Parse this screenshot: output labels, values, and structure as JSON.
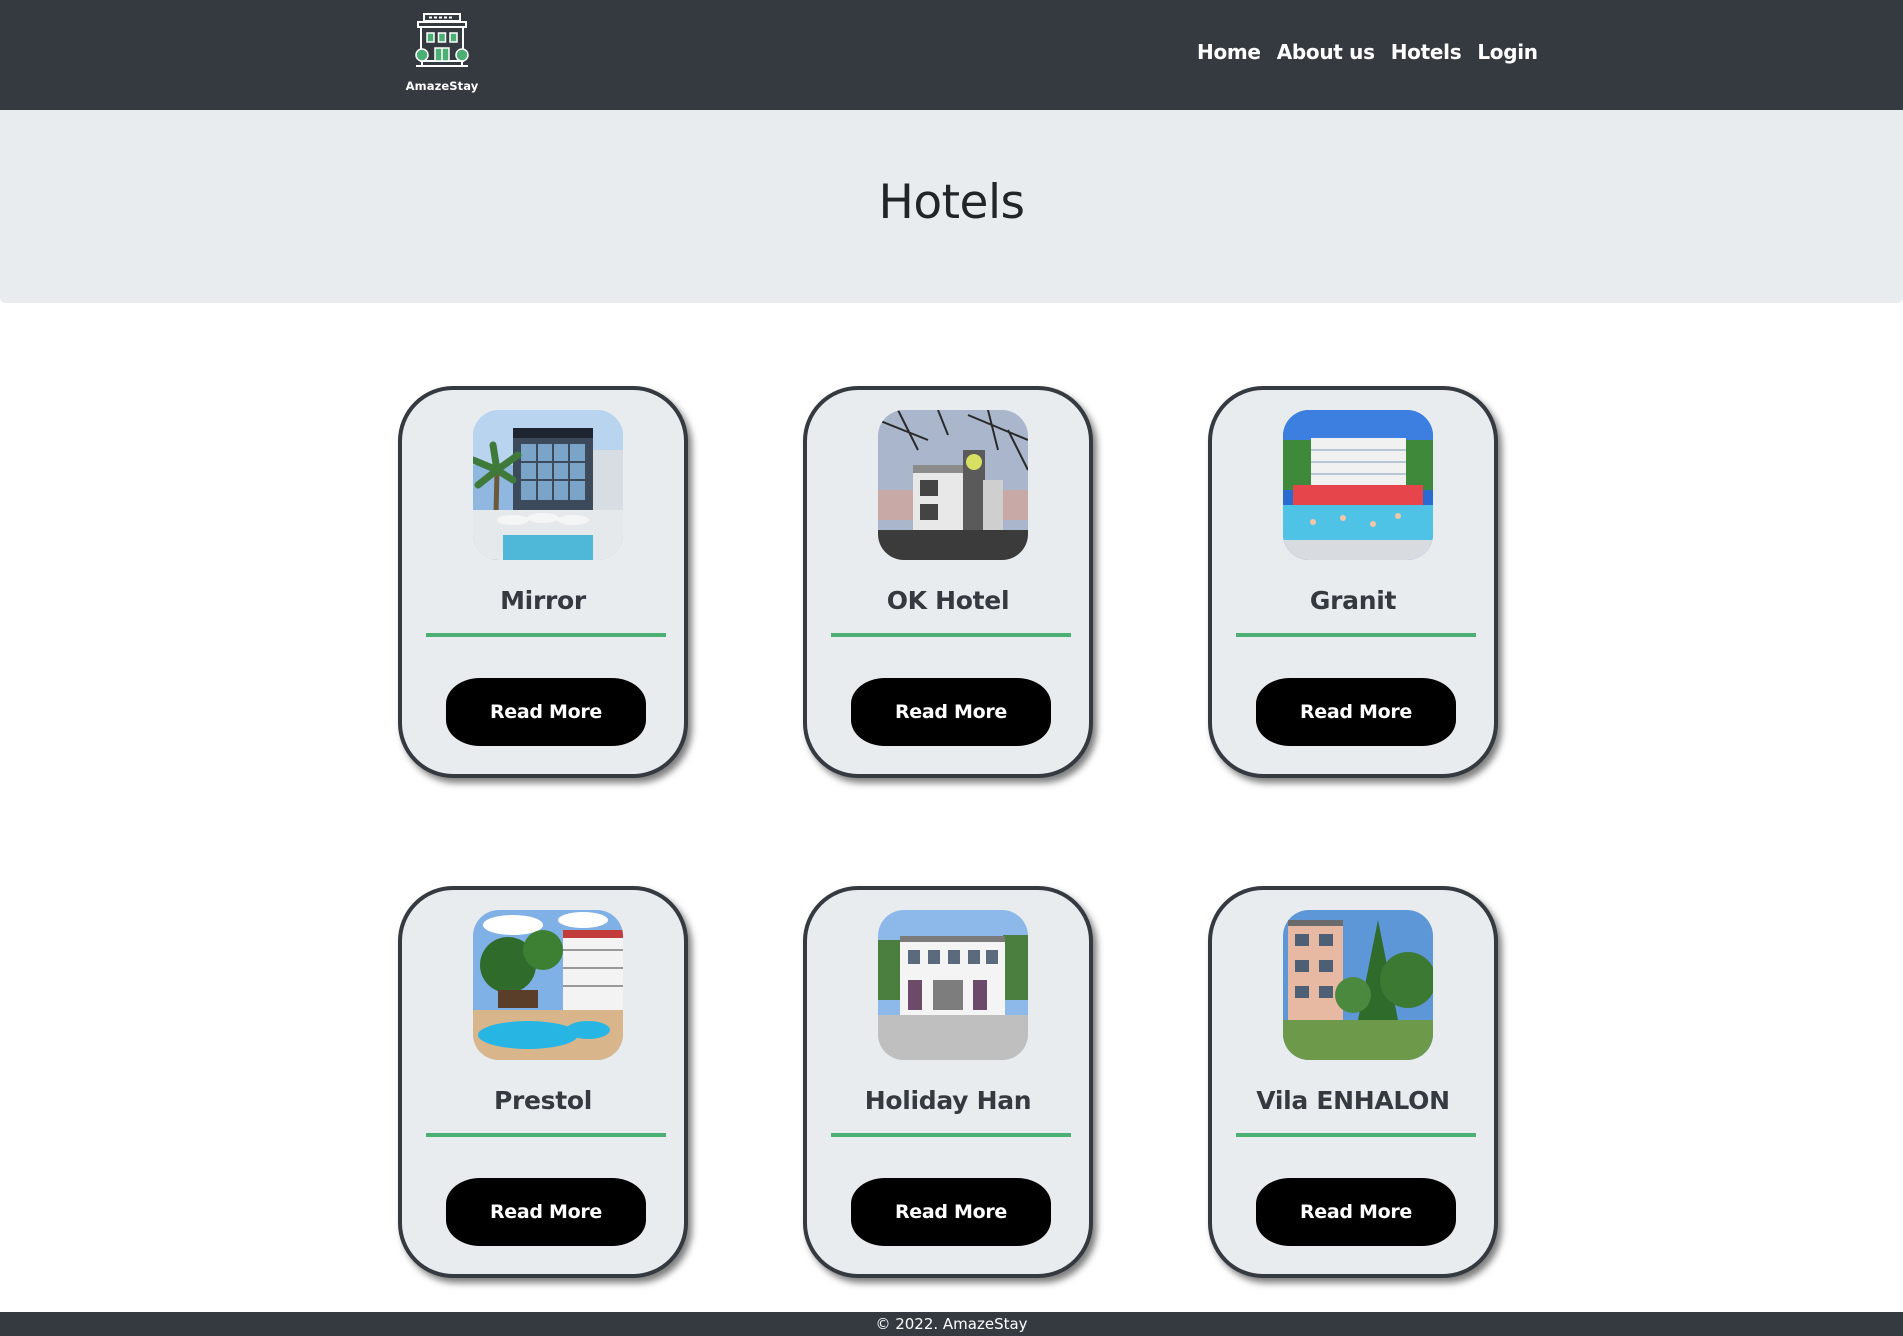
{
  "navbar": {
    "brand_name": "AmazeStay",
    "links": [
      {
        "label": "Home"
      },
      {
        "label": "About us"
      },
      {
        "label": "Hotels"
      },
      {
        "label": "Login"
      }
    ]
  },
  "page": {
    "title": "Hotels"
  },
  "hotels": [
    {
      "name": "Mirror",
      "button_label": "Read More",
      "image": "hotel-photo"
    },
    {
      "name": "OK Hotel",
      "button_label": "Read More",
      "image": "hotel-photo"
    },
    {
      "name": "Granit",
      "button_label": "Read More",
      "image": "hotel-photo"
    },
    {
      "name": "Prestol",
      "button_label": "Read More",
      "image": "hotel-photo"
    },
    {
      "name": "Holiday Han",
      "button_label": "Read More",
      "image": "hotel-photo"
    },
    {
      "name": "Vila ENHALON",
      "button_label": "Read More",
      "image": "hotel-photo"
    }
  ],
  "footer": {
    "text": "© 2022. AmazeStay"
  },
  "colors": {
    "navbar_bg": "#343a40",
    "jumbotron_bg": "#e9ecef",
    "card_bg": "#e9ecef",
    "accent_line": "#4caf74",
    "button_bg": "#000000"
  }
}
